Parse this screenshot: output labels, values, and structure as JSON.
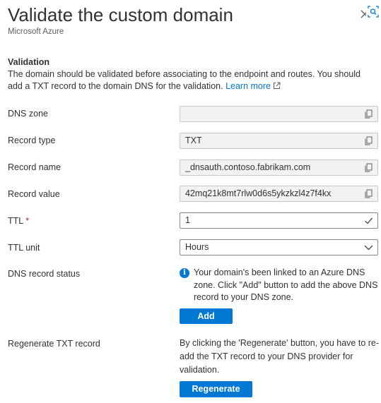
{
  "panel": {
    "title": "Validate the custom domain",
    "subtitle": "Microsoft Azure",
    "close_icon": "close-icon",
    "lens_icon": "visual-search-icon"
  },
  "validation": {
    "heading": "Validation",
    "description": "The domain should be validated before associating to the endpoint and routes. You should add a TXT record to the domain DNS for the validation.",
    "learn_more": "Learn more"
  },
  "fields": {
    "dns_zone": {
      "label": "DNS zone",
      "value": ""
    },
    "record_type": {
      "label": "Record type",
      "value": "TXT"
    },
    "record_name": {
      "label": "Record name",
      "value": "_dnsauth.contoso.fabrikam.com"
    },
    "record_value": {
      "label": "Record value",
      "value": "42mq21k8mt7rlw0d6s5ykzkzl4z7f4kx"
    },
    "ttl": {
      "label": "TTL",
      "required_mark": "*",
      "value": "1"
    },
    "ttl_unit": {
      "label": "TTL unit",
      "value": "Hours"
    }
  },
  "dns_status": {
    "label": "DNS record status",
    "message": "Your domain's been linked to an Azure DNS zone. Click \"Add\" button to add the above DNS record to your DNS zone.",
    "add_button": "Add"
  },
  "regenerate": {
    "label": "Regenerate TXT record",
    "message": "By clicking the 'Regenerate' button, you have to re-add the TXT record to your DNS provider for validation.",
    "button": "Regenerate"
  },
  "colors": {
    "accent": "#0078d4",
    "required": "#a4262c",
    "readonly_bg": "#f3f2f1"
  }
}
